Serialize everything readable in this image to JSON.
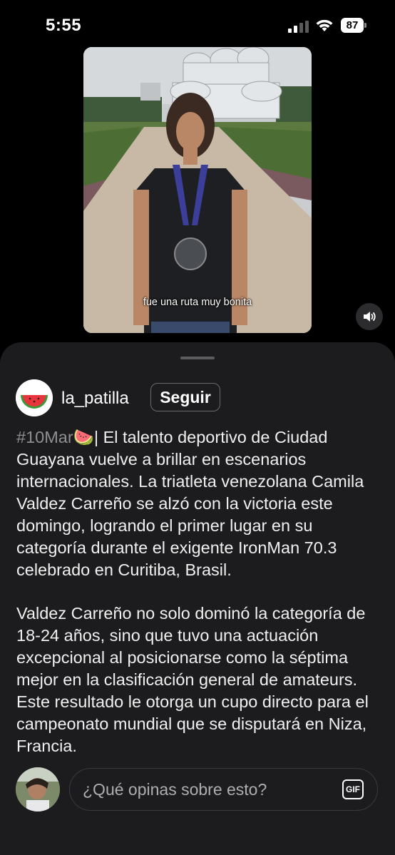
{
  "status_bar": {
    "time": "5:55",
    "battery_level": "87",
    "icons": [
      "cellular-signal-icon",
      "wifi-icon",
      "battery-icon"
    ]
  },
  "video": {
    "subtitle": "fue una ruta muy bonita",
    "sound_icon": "speaker-volume-icon"
  },
  "post": {
    "username": "la_patilla",
    "follow_label": "Seguir",
    "hashtag": "#10Mar",
    "emoji": "🍉",
    "caption_first": "| El talento deportivo de Ciudad Guayana vuelve a brillar en escenarios internacionales. La triatleta venezolana Camila Valdez Carreño se alzó con la victoria este domingo, logrando el primer lugar en su categoría durante el exigente IronMan 70.3 celebrado en Curitiba, Brasil.",
    "caption_second": "Valdez Carreño no solo dominó la categoría de 18-24 años, sino que tuvo una actuación excepcional al posicionarse como la séptima mejor en la clasificación general de amateurs. Este resultado le otorga un cupo directo para el campeonato mundial que se disputará en Niza, Francia."
  },
  "comment": {
    "placeholder": "¿Qué opinas sobre esto?",
    "gif_label": "GIF"
  },
  "colors": {
    "sheet_background": "#1c1c1e",
    "hashtag": "#8e8e93",
    "watermelon_red": "#e8343b",
    "watermelon_green": "#3a9a3a"
  }
}
